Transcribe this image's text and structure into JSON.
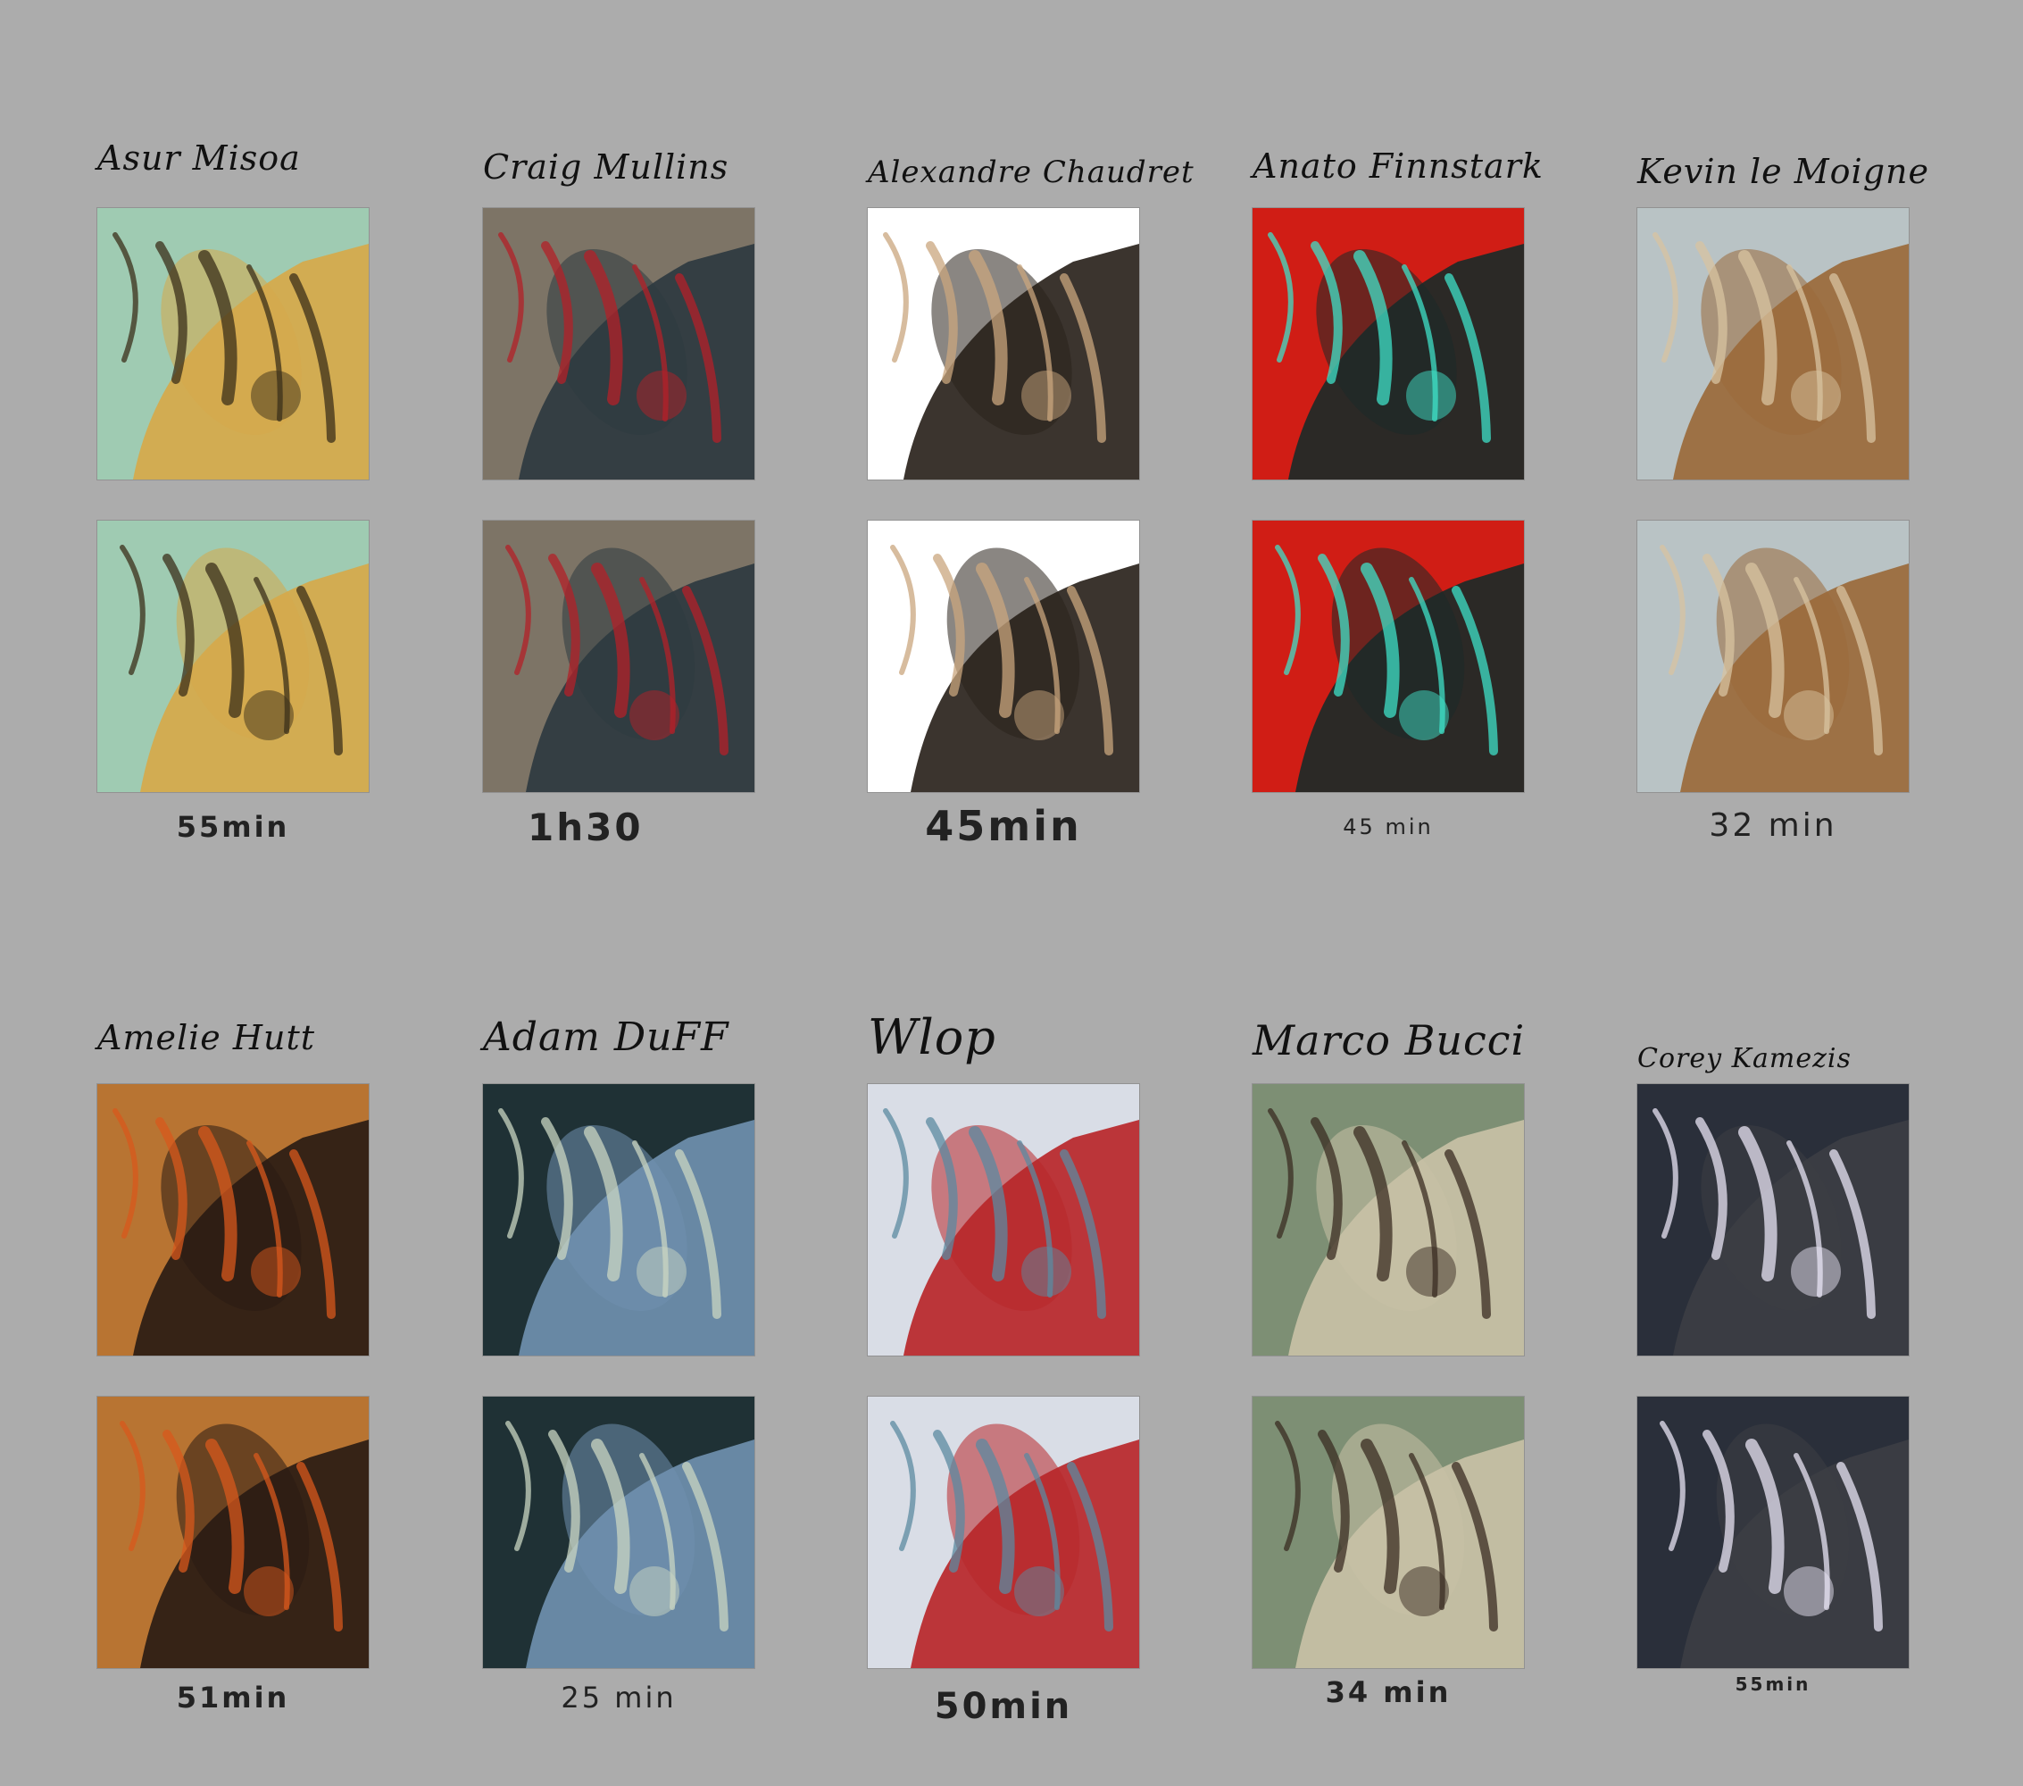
{
  "rows": [
    {
      "studies": [
        {
          "artist": "Asur Misoa",
          "duration": "55min",
          "reference_icon": "winged-dryad-painting",
          "study_icon": "winged-dryad-study",
          "colors": {
            "bg": "#9fcbb2",
            "main": "#d6a94a",
            "accent": "#3b2f1a"
          }
        },
        {
          "artist": "Craig Mullins",
          "duration": "1h30",
          "reference_icon": "armored-assassin-painting",
          "study_icon": "armored-assassin-study",
          "colors": {
            "bg": "#7d7466",
            "main": "#2e3a40",
            "accent": "#b32028"
          }
        },
        {
          "artist": "Alexandre Chaudret",
          "duration": "45min",
          "reference_icon": "dark-figure-painting",
          "study_icon": "dark-figure-study",
          "colors": {
            "bg": "#ffffff",
            "main": "#2a231c",
            "accent": "#c9a57d"
          }
        },
        {
          "artist": "Anato Finnstark",
          "duration": "45 min",
          "reference_icon": "red-warrior-painting",
          "study_icon": "red-warrior-study",
          "colors": {
            "bg": "#d01d15",
            "main": "#1c2a28",
            "accent": "#3fe0c8"
          }
        },
        {
          "artist": "Kevin le Moigne",
          "duration": "32 min",
          "reference_icon": "desert-arch-painting",
          "study_icon": "desert-arch-study",
          "colors": {
            "bg": "#b9c3c5",
            "main": "#9a6a3a",
            "accent": "#d8c3a0"
          }
        }
      ]
    },
    {
      "studies": [
        {
          "artist": "Amelie Hutt",
          "duration": "51min",
          "reference_icon": "red-haired-warrior-painting",
          "study_icon": "red-haired-warrior-study",
          "colors": {
            "bg": "#b87432",
            "main": "#2a1c14",
            "accent": "#d8581c"
          }
        },
        {
          "artist": "Adam DuFF",
          "duration": "25 min",
          "reference_icon": "waterfall-painting",
          "study_icon": "waterfall-study",
          "colors": {
            "bg": "#1f3135",
            "main": "#6f8fae",
            "accent": "#c9d6c2"
          }
        },
        {
          "artist": "Wlop",
          "duration": "50min",
          "reference_icon": "princess-knight-painting",
          "study_icon": "princess-knight-study",
          "colors": {
            "bg": "#d9dde6",
            "main": "#b8262a",
            "accent": "#5b8aa0"
          }
        },
        {
          "artist": "Marco Bucci",
          "duration": "34 min",
          "reference_icon": "crocodile-skull-painting",
          "study_icon": "crocodile-skull-study",
          "colors": {
            "bg": "#7d8f74",
            "main": "#c8c1a6",
            "accent": "#3a2c22"
          }
        },
        {
          "artist": "Corey Kamezis",
          "duration": "55min",
          "reference_icon": "dark-airship-painting",
          "study_icon": "dark-airship-study",
          "colors": {
            "bg": "#2a2f3a",
            "main": "#3c3e44",
            "accent": "#e8e4f4"
          }
        }
      ]
    }
  ]
}
